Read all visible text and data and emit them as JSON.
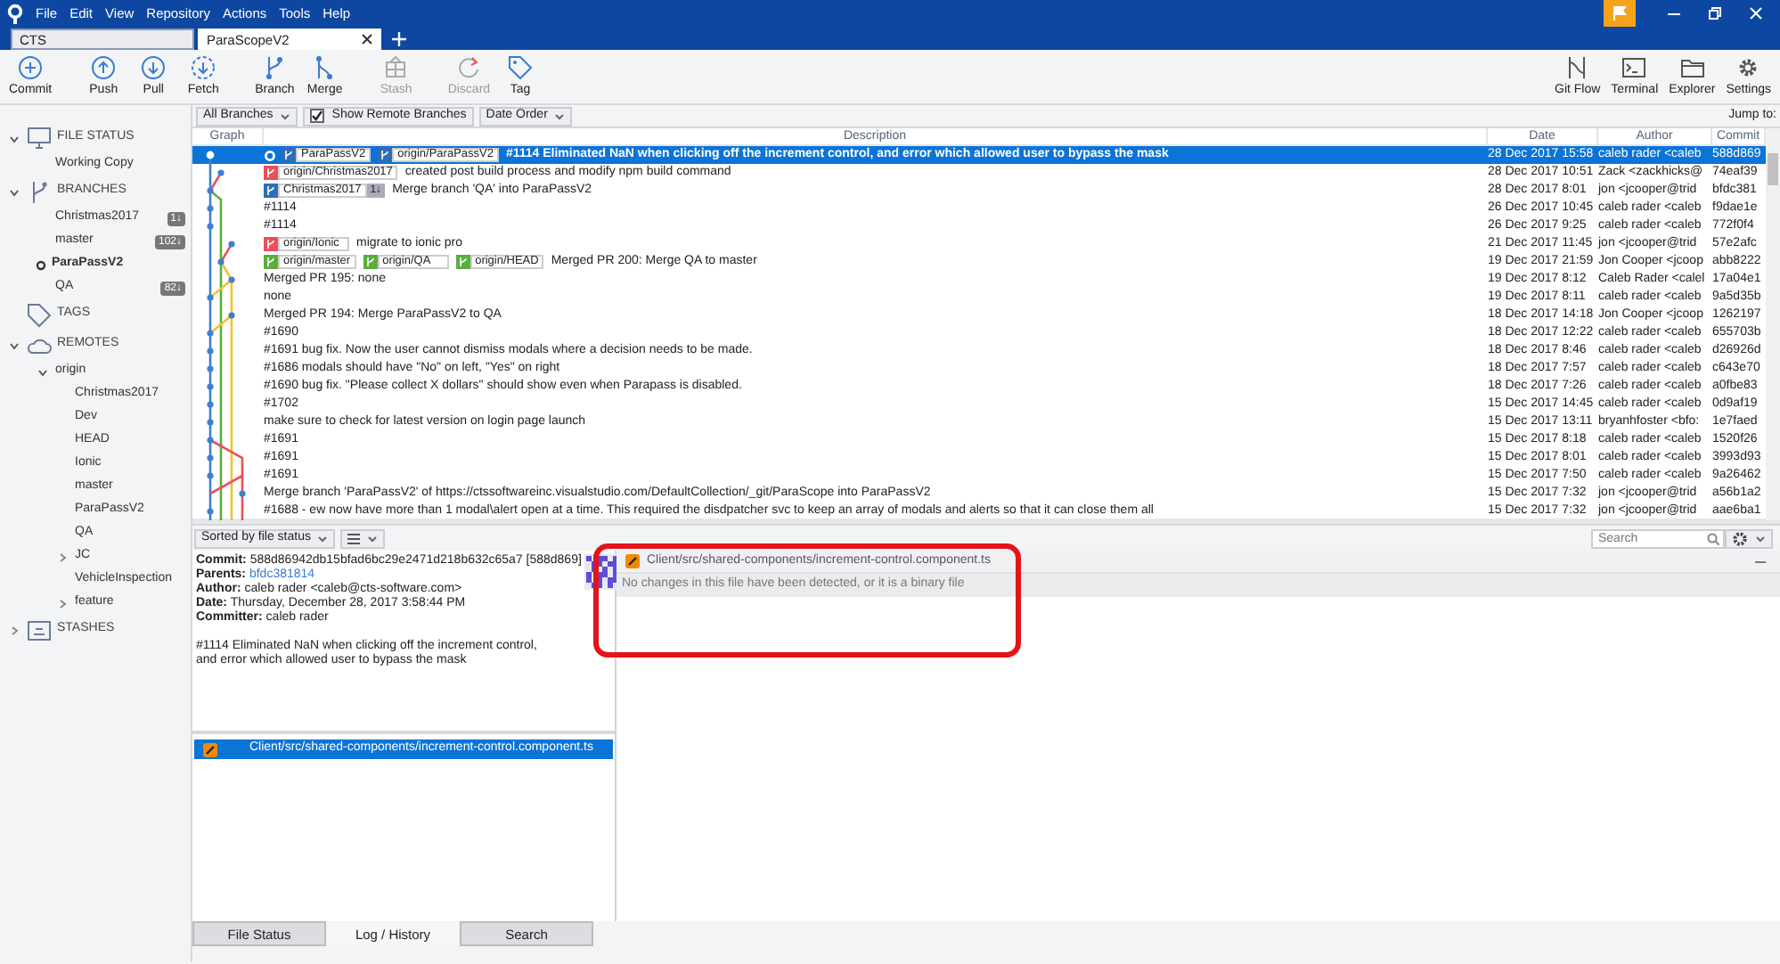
{
  "window": {
    "menu": [
      "File",
      "Edit",
      "View",
      "Repository",
      "Actions",
      "Tools",
      "Help"
    ]
  },
  "repo_tabs": [
    {
      "label": "CTS",
      "selected": false
    },
    {
      "label": "ParaScopeV2",
      "selected": true
    }
  ],
  "toolbar": {
    "groups": [
      [
        {
          "label": "Commit",
          "disabled": false
        }
      ],
      [
        {
          "label": "Push",
          "disabled": false
        },
        {
          "label": "Pull",
          "disabled": false
        },
        {
          "label": "Fetch",
          "disabled": false
        }
      ],
      [
        {
          "label": "Branch",
          "disabled": false
        },
        {
          "label": "Merge",
          "disabled": false
        }
      ],
      [
        {
          "label": "Stash",
          "disabled": true
        }
      ],
      [
        {
          "label": "Discard",
          "disabled": true
        },
        {
          "label": "Tag",
          "disabled": false
        }
      ]
    ],
    "right": [
      {
        "label": "Git Flow",
        "disabled": false
      },
      {
        "label": "Terminal",
        "disabled": false
      },
      {
        "label": "Explorer",
        "disabled": false
      },
      {
        "label": "Settings",
        "disabled": false
      }
    ]
  },
  "sidebar": {
    "sections": [
      {
        "title": "FILE STATUS",
        "expanded": true,
        "items": [
          {
            "label": "Working Copy"
          }
        ]
      },
      {
        "title": "BRANCHES",
        "expanded": true,
        "items": [
          {
            "label": "Christmas2017",
            "badge": "1↓",
            "current": false
          },
          {
            "label": "master",
            "badge": "102↓",
            "current": false
          },
          {
            "label": "ParaPassV2",
            "current": true
          },
          {
            "label": "QA",
            "badge": "82↓",
            "current": false
          }
        ]
      },
      {
        "title": "TAGS"
      },
      {
        "title": "REMOTES",
        "expanded": true,
        "items": [
          {
            "label": "origin",
            "expanded": true,
            "children": [
              {
                "label": "Christmas2017"
              },
              {
                "label": "Dev"
              },
              {
                "label": "HEAD"
              },
              {
                "label": "Ionic"
              },
              {
                "label": "master"
              },
              {
                "label": "ParaPassV2"
              },
              {
                "label": "QA"
              },
              {
                "label": "JC",
                "expanded": false
              },
              {
                "label": "VehicleInspection"
              },
              {
                "label": "feature",
                "expanded": false
              }
            ]
          }
        ]
      },
      {
        "title": "STASHES",
        "expanded": false
      }
    ]
  },
  "log": {
    "branch_filter": "All Branches",
    "show_remote": {
      "label": "Show Remote Branches",
      "checked": true
    },
    "order": "Date Order",
    "jump_to": "Jump to:",
    "columns": [
      "Graph",
      "Description",
      "Date",
      "Author",
      "Commit"
    ],
    "rows": [
      {
        "refs": [
          {
            "name": "ParaPassV2",
            "color": "#2f6db5",
            "current": true
          },
          {
            "name": "origin/ParaPassV2",
            "color": "#2f6db5",
            "current": false
          }
        ],
        "description": "#1114 Eliminated NaN when clicking off the increment control, and error which allowed user to bypass the mask",
        "date": "28 Dec 2017 15:58",
        "author": "caleb rader <caleb",
        "commit": "588d869",
        "selected": true
      },
      {
        "refs": [
          {
            "name": "origin/Christmas2017",
            "color": "#e8505b",
            "current": false
          }
        ],
        "description": "created post build process and modify npm build command",
        "date": "28 Dec 2017 10:51",
        "author": "Zack <zackhicks@",
        "commit": "74eaf39",
        "selected": false
      },
      {
        "refs": [
          {
            "name": "Christmas2017",
            "color": "#2f6db5",
            "current": false,
            "count": "1↓"
          }
        ],
        "description": "Merge branch 'QA' into ParaPassV2",
        "date": "28 Dec 2017 8:01",
        "author": "jon <jcooper@trid",
        "commit": "bfdc381",
        "selected": false
      },
      {
        "description": "#1114",
        "date": "26 Dec 2017 10:45",
        "author": "caleb rader <caleb",
        "commit": "f9dae1e",
        "selected": false
      },
      {
        "description": "#1114",
        "date": "26 Dec 2017 9:25",
        "author": "caleb rader <caleb",
        "commit": "772f0f4",
        "selected": false
      },
      {
        "refs": [
          {
            "name": "origin/Ionic",
            "color": "#e8505b",
            "current": false
          }
        ],
        "description": "migrate to ionic pro",
        "date": "21 Dec 2017 11:45",
        "author": "jon <jcooper@trid",
        "commit": "57e2afc",
        "selected": false
      },
      {
        "refs": [
          {
            "name": "origin/master",
            "color": "#5aae3c",
            "current": false
          },
          {
            "name": "origin/QA",
            "color": "#5aae3c",
            "current": false
          },
          {
            "name": "origin/HEAD",
            "color": "#5aae3c",
            "current": false
          }
        ],
        "description": "Merged PR 200: Merge QA to master",
        "date": "19 Dec 2017 21:59",
        "author": "Jon Cooper <jcoop",
        "commit": "abb8222",
        "selected": false
      },
      {
        "description": "Merged PR 195: none",
        "date": "19 Dec 2017 8:12",
        "author": "Caleb Rader <calel",
        "commit": "17a04e1",
        "selected": false
      },
      {
        "description": "none",
        "date": "19 Dec 2017 8:11",
        "author": "caleb rader <caleb",
        "commit": "9a5d35b",
        "selected": false
      },
      {
        "description": "Merged PR 194: Merge ParaPassV2 to QA",
        "date": "18 Dec 2017 14:18",
        "author": "Jon Cooper <jcoop",
        "commit": "1262197",
        "selected": false
      },
      {
        "description": "#1690",
        "date": "18 Dec 2017 12:22",
        "author": "caleb rader <caleb",
        "commit": "655703b",
        "selected": false
      },
      {
        "description": "#1691 bug fix. Now the user cannot dismiss modals where a decision needs to be made.",
        "date": "18 Dec 2017 8:46",
        "author": "caleb rader <caleb",
        "commit": "d26926d",
        "selected": false
      },
      {
        "description": "#1686 modals should have \"No\" on left, \"Yes\" on right",
        "date": "18 Dec 2017 7:57",
        "author": "caleb rader <caleb",
        "commit": "c643e70",
        "selected": false
      },
      {
        "description": "#1690 bug fix. \"Please collect X dollars\" should show even when Parapass is disabled.",
        "date": "18 Dec 2017 7:26",
        "author": "caleb rader <caleb",
        "commit": "a0fbe83",
        "selected": false
      },
      {
        "description": "#1702",
        "date": "15 Dec 2017 14:45",
        "author": "caleb rader <caleb",
        "commit": "0d9af19",
        "selected": false
      },
      {
        "description": "make sure to check for latest version on login page launch",
        "date": "15 Dec 2017 13:11",
        "author": "bryanhfoster <bfo:",
        "commit": "1e7faed",
        "selected": false
      },
      {
        "description": "#1691",
        "date": "15 Dec 2017 8:18",
        "author": "caleb rader <caleb",
        "commit": "1520f26",
        "selected": false
      },
      {
        "description": "#1691",
        "date": "15 Dec 2017 8:01",
        "author": "caleb rader <caleb",
        "commit": "3993d93",
        "selected": false
      },
      {
        "description": "#1691",
        "date": "15 Dec 2017 7:50",
        "author": "caleb rader <caleb",
        "commit": "9a26462",
        "selected": false
      },
      {
        "description": "Merge branch 'ParaPassV2' of https://ctssoftwareinc.visualstudio.com/DefaultCollection/_git/ParaScope into ParaPassV2",
        "date": "15 Dec 2017 7:32",
        "author": "jon <jcooper@trid",
        "commit": "a56b1a2",
        "selected": false
      },
      {
        "description": "#1688 -  ew now have more than 1 modal\\alert open at a time. This required the disdpatcher svc to keep an array of modals and alerts so that it can close them all",
        "date": "15 Dec 2017 7:32",
        "author": "jon <jcooper@trid",
        "commit": "aae6ba1",
        "selected": false
      }
    ]
  },
  "details": {
    "sort": "Sorted by file status",
    "fields": [
      {
        "label": "Commit:",
        "value": "588d86942db15bfad6bc29e2471d218b632c65a7 [588d869]",
        "kind": "text"
      },
      {
        "label": "Parents:",
        "value": "bfdc381814",
        "kind": "link"
      },
      {
        "label": "Author:",
        "value": "caleb rader <caleb@cts-software.com>",
        "kind": "text"
      },
      {
        "label": "Date:",
        "value": "Thursday, December 28, 2017 3:58:44 PM",
        "kind": "text"
      },
      {
        "label": "Committer:",
        "value": "caleb rader",
        "kind": "text"
      }
    ],
    "message": "#1114 Eliminated NaN when clicking off the increment control, and error which allowed user to bypass the mask",
    "files": [
      {
        "path": "Client/src/shared-components/increment-control.component.ts",
        "selected": true
      }
    ]
  },
  "diff": {
    "search_placeholder": "Search",
    "file": "Client/src/shared-components/increment-control.component.ts",
    "notice": "No changes in this file have been detected, or it is a binary file"
  },
  "bottom_tabs": [
    {
      "label": "File Status",
      "selected": false
    },
    {
      "label": "Log / History",
      "selected": true
    },
    {
      "label": "Search",
      "selected": false
    }
  ],
  "highlight_frame": true
}
